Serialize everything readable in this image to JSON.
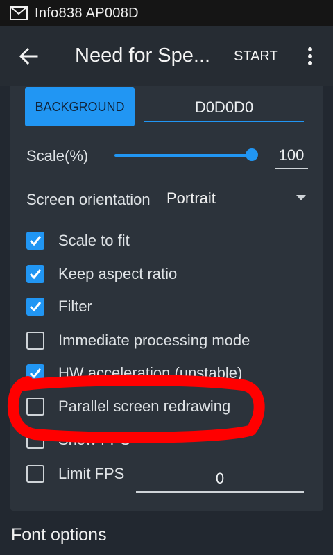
{
  "status_bar": {
    "text": "Info838 AP008D",
    "icon": "mail-icon"
  },
  "app_bar": {
    "title": "Need for Spe...",
    "start_label": "START"
  },
  "settings": {
    "background_button": "BACKGROUND",
    "background_value": "D0D0D0",
    "scale_label": "Scale(%)",
    "scale_value": "100",
    "scale_fraction": 1.0,
    "orientation_label": "Screen orientation",
    "orientation_value": "Portrait",
    "checkboxes": [
      {
        "label": "Scale to fit",
        "checked": true
      },
      {
        "label": "Keep aspect ratio",
        "checked": true
      },
      {
        "label": "Filter",
        "checked": true
      },
      {
        "label": "Immediate processing mode",
        "checked": false
      },
      {
        "label": "HW acceleration (unstable)",
        "checked": true
      },
      {
        "label": "Parallel screen redrawing",
        "checked": false
      },
      {
        "label": "Show FPS",
        "checked": false
      },
      {
        "label": "Limit FPS",
        "checked": false
      }
    ],
    "limit_fps_value": "0"
  },
  "section_title": "Font options",
  "colors": {
    "accent": "#2196f3",
    "annotation": "#ff0000"
  }
}
